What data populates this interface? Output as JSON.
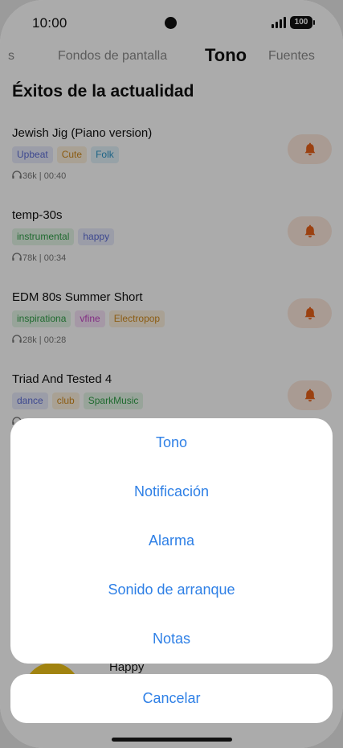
{
  "status": {
    "time": "10:00",
    "battery": "100"
  },
  "tabs": [
    {
      "label": "s",
      "active": false
    },
    {
      "label": "Fondos de pantalla",
      "active": false
    },
    {
      "label": "Tono",
      "active": true
    },
    {
      "label": "Fuentes",
      "active": false
    }
  ],
  "section_title": "Éxitos de la actualidad",
  "tracks": [
    {
      "title": "Jewish Jig (Piano version)",
      "tags": [
        {
          "label": "Upbeat",
          "color": "#5b6cd6",
          "bg": "#e8ebfb"
        },
        {
          "label": "Cute",
          "color": "#d08a1e",
          "bg": "#fdf1dd"
        },
        {
          "label": "Folk",
          "color": "#2c95c8",
          "bg": "#e2f2fa"
        }
      ],
      "plays": "36k",
      "duration": "00:40"
    },
    {
      "title": "temp-30s",
      "tags": [
        {
          "label": "instrumental",
          "color": "#2f9e47",
          "bg": "#e3f5e6"
        },
        {
          "label": "happy",
          "color": "#5b6cd6",
          "bg": "#e8ebfb"
        }
      ],
      "plays": "78k",
      "duration": "00:34"
    },
    {
      "title": "EDM 80s Summer Short",
      "tags": [
        {
          "label": "inspirationa",
          "color": "#2f9e47",
          "bg": "#e3f5e6"
        },
        {
          "label": "vfine",
          "color": "#c244c4",
          "bg": "#f7e3f8"
        },
        {
          "label": "Electropop",
          "color": "#d08a1e",
          "bg": "#fdf1dd"
        }
      ],
      "plays": "28k",
      "duration": "00:28"
    },
    {
      "title": "Triad And Tested 4",
      "tags": [
        {
          "label": "dance",
          "color": "#5b6cd6",
          "bg": "#e8ebfb"
        },
        {
          "label": "club",
          "color": "#d08a1e",
          "bg": "#fdf1dd"
        },
        {
          "label": "SparkMusic",
          "color": "#2f9e47",
          "bg": "#e3f5e6"
        }
      ],
      "plays": "",
      "duration": ""
    }
  ],
  "peek_track": {
    "title": "Happy"
  },
  "sheet": {
    "items": [
      "Tono",
      "Notificación",
      "Alarma",
      "Sonido de arranque",
      "Notas"
    ],
    "cancel": "Cancelar"
  },
  "colors": {
    "accent_blue": "#2f80e6",
    "bell_orange": "#e8611a",
    "bell_bg": "#fde8dc"
  },
  "icons": {
    "bell": "bell-icon",
    "headphones": "headphones-icon",
    "signal": "cellular-signal-icon",
    "battery": "battery-icon"
  }
}
